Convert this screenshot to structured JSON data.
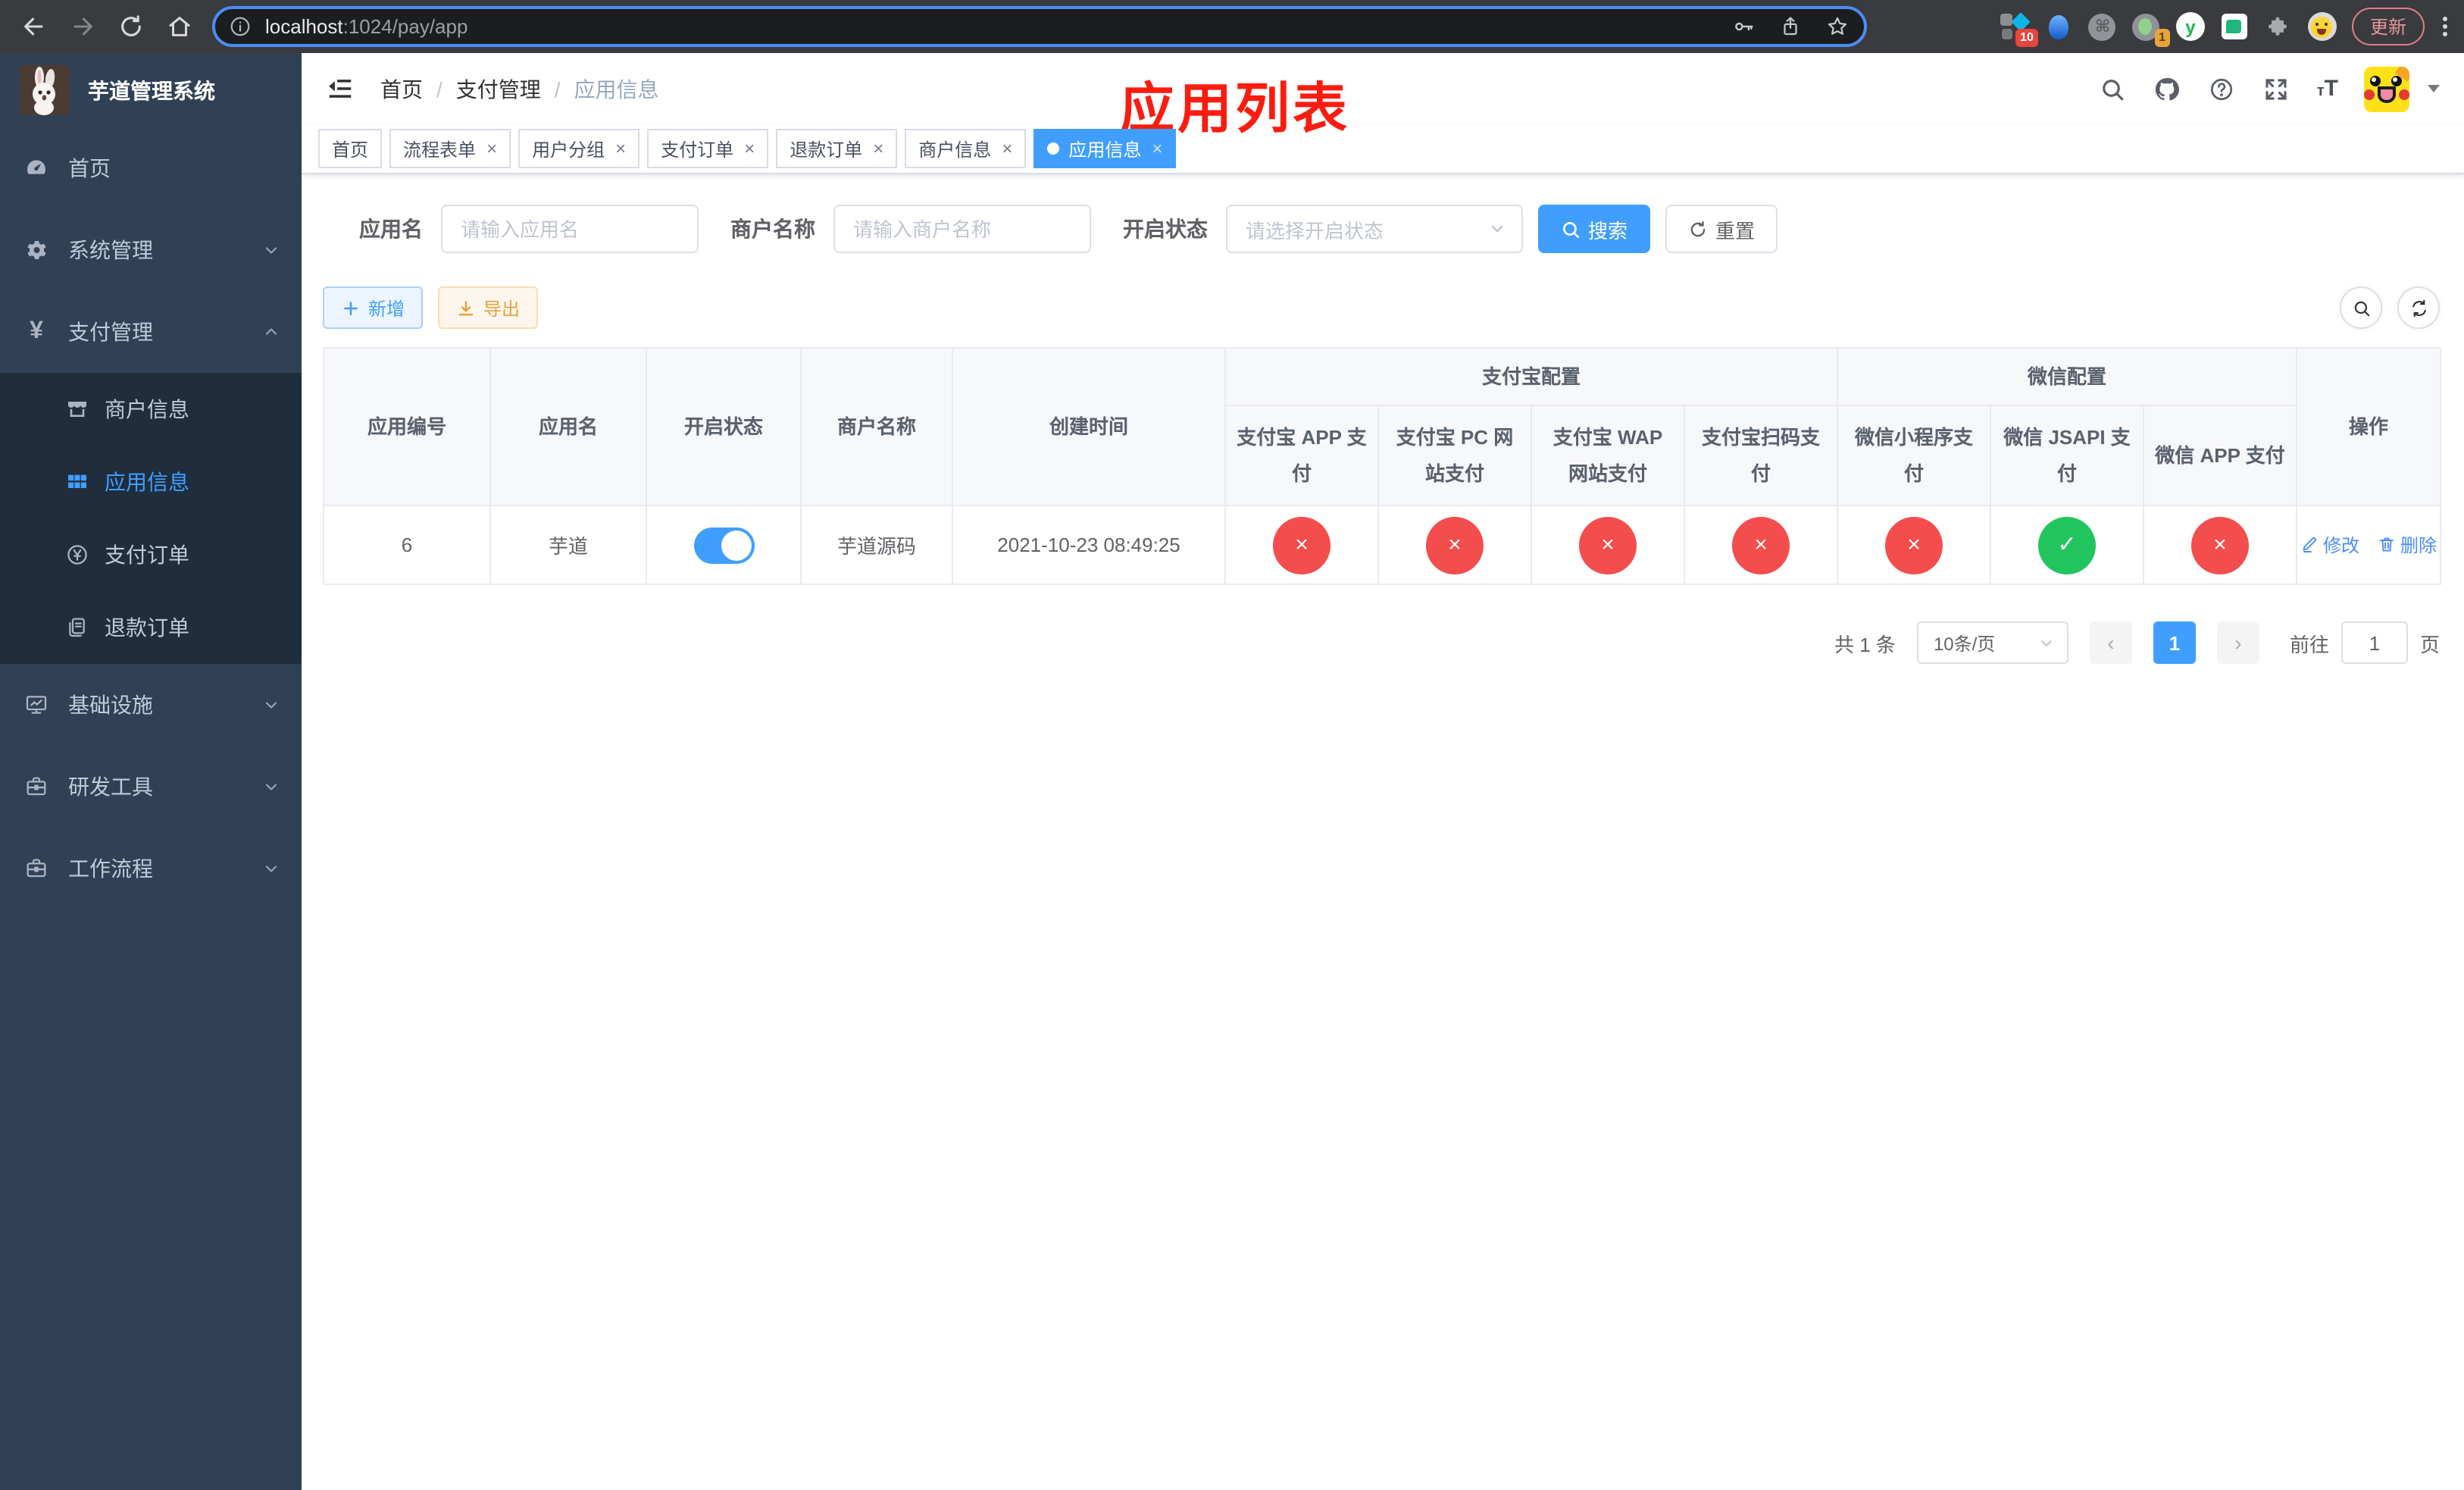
{
  "browser": {
    "url_host": "localhost",
    "url_path": ":1024/pay/app",
    "update_label": "更新",
    "ext_badge_pin": "10",
    "ext_badge_cam": "1"
  },
  "sidebar": {
    "logo_title": "芋道管理系统",
    "items": [
      {
        "key": "home",
        "label": "首页",
        "icon": "dashboard-icon"
      },
      {
        "key": "system",
        "label": "系统管理",
        "icon": "gear-icon",
        "caret": "down"
      },
      {
        "key": "payment",
        "label": "支付管理",
        "icon": "yen-icon",
        "caret": "up",
        "expanded": true,
        "children": [
          {
            "key": "merchant-info",
            "label": "商户信息",
            "icon": "shop-icon"
          },
          {
            "key": "app-info",
            "label": "应用信息",
            "icon": "grid-icon",
            "active": true
          },
          {
            "key": "pay-order",
            "label": "支付订单",
            "icon": "yen-circle-icon"
          },
          {
            "key": "refund-order",
            "label": "退款订单",
            "icon": "document-icon"
          }
        ]
      },
      {
        "key": "infrastructure",
        "label": "基础设施",
        "icon": "monitor-icon",
        "caret": "down"
      },
      {
        "key": "dev-tools",
        "label": "研发工具",
        "icon": "briefcase-icon",
        "caret": "down"
      },
      {
        "key": "workflow",
        "label": "工作流程",
        "icon": "briefcase-icon",
        "caret": "down"
      }
    ]
  },
  "header": {
    "breadcrumb": [
      "首页",
      "支付管理",
      "应用信息"
    ],
    "annotation": "应用列表"
  },
  "tabs": [
    {
      "key": "home",
      "label": "首页",
      "closable": false,
      "active": false
    },
    {
      "key": "flow-form",
      "label": "流程表单",
      "closable": true,
      "active": false
    },
    {
      "key": "user-group",
      "label": "用户分组",
      "closable": true,
      "active": false
    },
    {
      "key": "pay-order",
      "label": "支付订单",
      "closable": true,
      "active": false
    },
    {
      "key": "refund-order",
      "label": "退款订单",
      "closable": true,
      "active": false
    },
    {
      "key": "merchant-info",
      "label": "商户信息",
      "closable": true,
      "active": false
    },
    {
      "key": "app-info",
      "label": "应用信息",
      "closable": true,
      "active": true
    }
  ],
  "filters": {
    "app_name_label": "应用名",
    "app_name_placeholder": "请输入应用名",
    "merchant_label": "商户名称",
    "merchant_placeholder": "请输入商户名称",
    "status_label": "开启状态",
    "status_placeholder": "请选择开启状态",
    "search_label": "搜索",
    "reset_label": "重置"
  },
  "toolbar": {
    "add_label": "新增",
    "export_label": "导出"
  },
  "table": {
    "left_headers": [
      "应用编号",
      "应用名",
      "开启状态",
      "商户名称",
      "创建时间"
    ],
    "groups": [
      {
        "label": "支付宝配置",
        "cols": [
          "支付宝 APP 支付",
          "支付宝 PC 网站支付",
          "支付宝 WAP 网站支付",
          "支付宝扫码支付"
        ]
      },
      {
        "label": "微信配置",
        "cols": [
          "微信小程序支付",
          "微信 JSAPI 支付",
          "微信 APP 支付"
        ]
      }
    ],
    "op_header": "操作",
    "row": {
      "id": "6",
      "name": "芋道",
      "enabled": true,
      "merchant": "芋道源码",
      "created": "2021-10-23 08:49:25",
      "statuses": [
        false,
        false,
        false,
        false,
        false,
        true,
        false
      ],
      "edit_label": "修改",
      "delete_label": "删除"
    }
  },
  "pagination": {
    "total_text": "共 1 条",
    "page_size": "10条/页",
    "current_page": "1",
    "goto_label": "前往",
    "goto_value": "1",
    "page_suffix": "页"
  },
  "colors": {
    "accent": "#409eff",
    "danger": "#f34d4d",
    "success": "#21c45d",
    "annotation_red": "#fb1c10",
    "sidebar_bg": "#304156",
    "submenu_bg": "#1f2d3d"
  }
}
